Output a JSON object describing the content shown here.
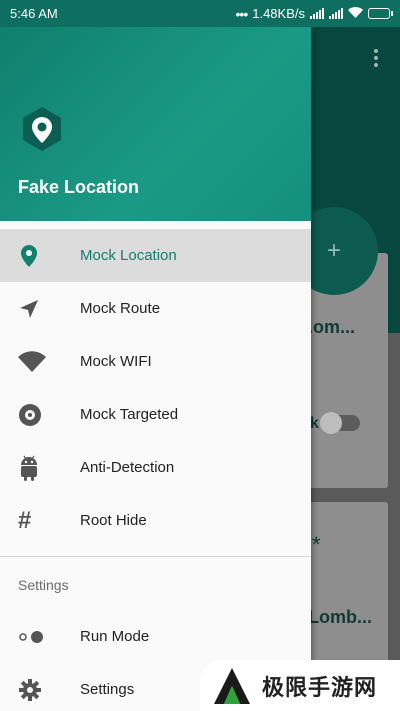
{
  "status_bar": {
    "time": "5:46 AM",
    "network_speed": "1.48KB/s",
    "icons": [
      "notification-dots-icon",
      "signal-icon",
      "signal-icon",
      "wifi-icon",
      "battery-icon"
    ]
  },
  "drawer": {
    "app_name": "Fake Location",
    "app_icon": "location-gear-icon",
    "items": [
      {
        "label": "Mock Location",
        "icon": "location-pin-icon",
        "selected": true
      },
      {
        "label": "Mock Route",
        "icon": "navigation-arrow-icon",
        "selected": false
      },
      {
        "label": "Mock WIFI",
        "icon": "wifi-icon",
        "selected": false
      },
      {
        "label": "Mock Targeted",
        "icon": "target-disc-icon",
        "selected": false
      },
      {
        "label": "Anti-Detection",
        "icon": "android-icon",
        "selected": false
      },
      {
        "label": "Root Hide",
        "icon": "hash-icon",
        "selected": false
      }
    ],
    "settings_section": {
      "title": "Settings",
      "items": [
        {
          "label": "Run Mode",
          "icon": "toggle-mode-icon"
        },
        {
          "label": "Settings",
          "icon": "gear-icon"
        }
      ]
    }
  },
  "background": {
    "card_texts": [
      ".om...",
      "k",
      "*",
      "Lomb..."
    ]
  },
  "watermark": {
    "text": "极限手游网"
  },
  "colors": {
    "accent": "#11806d",
    "header": "#14907c",
    "status_bar": "#0e6f60"
  }
}
